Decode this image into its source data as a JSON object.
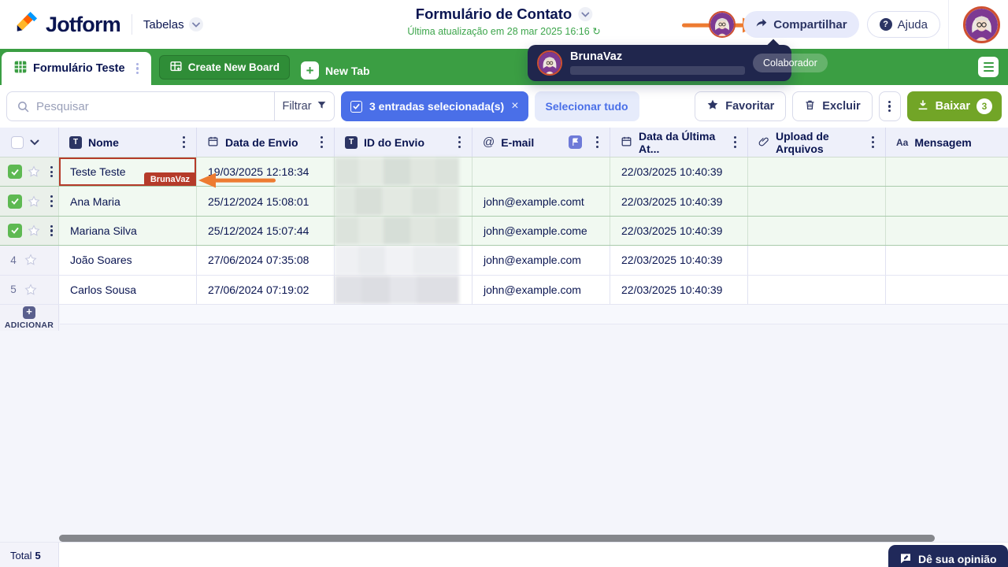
{
  "header": {
    "logo_text": "Jotform",
    "product_label": "Tabelas",
    "title": "Formulário de Contato",
    "subtitle": "Última atualização em 28 mar 2025 16:16",
    "share_label": "Compartilhar",
    "help_label": "Ajuda"
  },
  "user_tooltip": {
    "name": "BrunaVaz",
    "badge": "Colaborador"
  },
  "tab_bar": {
    "active_tab_label": "Formulário Teste",
    "create_board_label": "Create New Board",
    "new_tab_label": "New Tab"
  },
  "toolbar": {
    "search_placeholder": "Pesquisar",
    "filter_label": "Filtrar",
    "selected_chip_label": "3 entradas selecionada(s)",
    "select_all_label": "Selecionar tudo",
    "favorite_label": "Favoritar",
    "delete_label": "Excluir",
    "download_label": "Baixar",
    "download_count": "3"
  },
  "table": {
    "columns": [
      {
        "label": "",
        "icon": "checkbox"
      },
      {
        "label": "Nome",
        "icon": "text-field"
      },
      {
        "label": "Data de Envio",
        "icon": "calendar"
      },
      {
        "label": "ID do Envio",
        "icon": "text-field"
      },
      {
        "label": "E-mail",
        "icon": "at"
      },
      {
        "label": "Data da Última At...",
        "icon": "calendar"
      },
      {
        "label": "Upload de Arquivos",
        "icon": "paperclip"
      },
      {
        "label": "Mensagem",
        "icon": "Aa"
      }
    ],
    "rows": [
      {
        "checked": true,
        "name": "Teste Teste",
        "submit_date": "19/03/2025 12:18:34",
        "id_blurred": true,
        "email": "",
        "last_update": "22/03/2025 10:40:39",
        "collaborator_tag": "BrunaVaz"
      },
      {
        "checked": true,
        "name": "Ana Maria",
        "submit_date": "25/12/2024 15:08:01",
        "id_blurred": true,
        "email": "john@example.comt",
        "last_update": "22/03/2025 10:40:39"
      },
      {
        "checked": true,
        "name": "Mariana Silva",
        "submit_date": "25/12/2024 15:07:44",
        "id_blurred": true,
        "email": "john@example.come",
        "last_update": "22/03/2025 10:40:39"
      },
      {
        "checked": false,
        "num": "4",
        "name": "João Soares",
        "submit_date": "27/06/2024 07:35:08",
        "id_blurred": true,
        "email": "john@example.com",
        "last_update": "22/03/2025 10:40:39"
      },
      {
        "checked": false,
        "num": "5",
        "name": "Carlos Sousa",
        "submit_date": "27/06/2024 07:19:02",
        "id_blurred": true,
        "email": "john@example.com",
        "last_update": "22/03/2025 10:40:39"
      }
    ]
  },
  "add_row": {
    "label": "ADICIONAR"
  },
  "footer": {
    "total_label": "Total",
    "total_value": "5",
    "feedback_label": "Dê sua opinião"
  },
  "colors": {
    "brand_navy": "#0a1551",
    "brand_green": "#3b9e43",
    "accent_blue": "#4a6fe8",
    "download_green": "#72a527",
    "collaborator_red": "#b53b2a",
    "arrow_orange": "#ed7b31",
    "updated_green": "#3ca54b"
  }
}
